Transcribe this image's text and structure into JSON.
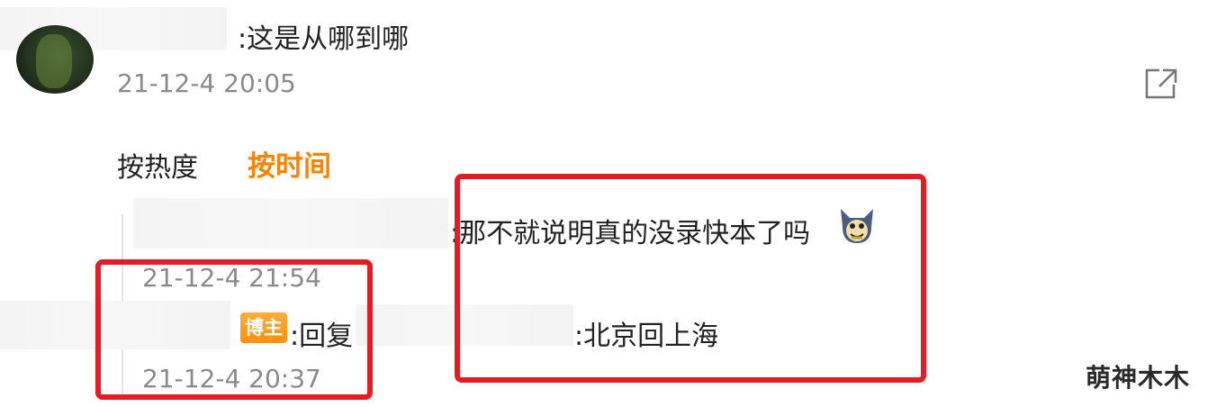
{
  "parent_comment": {
    "text": ":这是从哪到哪",
    "time": "21-12-4 20:05"
  },
  "sort_tabs": {
    "hot_label": "按热度",
    "time_label": "按时间"
  },
  "replies": [
    {
      "text": ":那不就说明真的没录快本了吗",
      "emoji": "tom-cat-emoji",
      "time": "21-12-4 21:54"
    },
    {
      "badge": "博主",
      "reply_prefix": ":回复",
      "text": ":北京回上海",
      "time": "21-12-4 20:37"
    }
  ],
  "watermark": "萌神木木",
  "colors": {
    "accent_orange": "#ff8200",
    "badge_orange": "#ff9a1f",
    "highlight_red": "#e51c23",
    "time_gray": "#8a8a8a"
  },
  "icons": {
    "share": "share-external-icon",
    "avatar": "user-avatar"
  }
}
